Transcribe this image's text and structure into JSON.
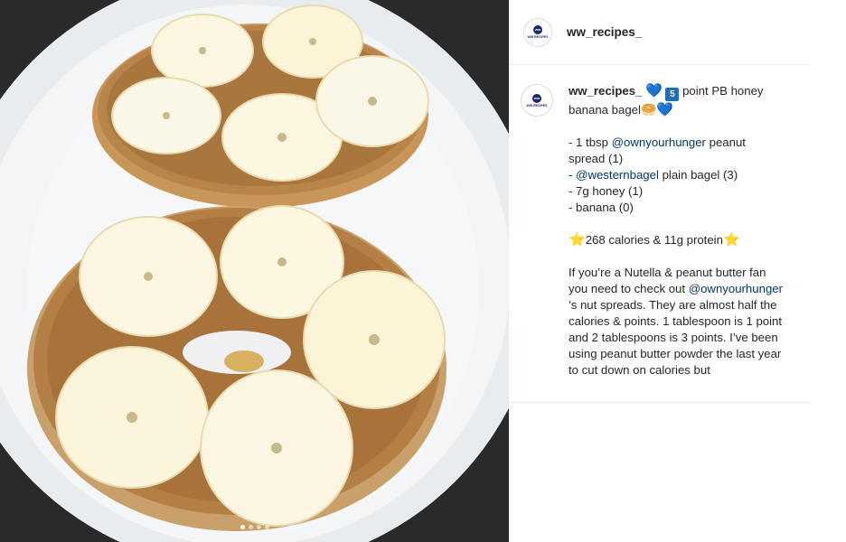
{
  "post": {
    "username": "ww_recipes_",
    "avatar_label": "WW RECIPES",
    "avatar_mark": "ww",
    "caption": {
      "username": "ww_recipes_",
      "title_part1": "point PB honey",
      "title_part2": "banana bagel",
      "emoji_heart": "💙",
      "emoji_number": "5",
      "emoji_bagel": "🥯",
      "ingredients": [
        {
          "prefix": "- 1 tbsp ",
          "mention": "@ownyourhunger",
          "suffix": " peanut spread (1)"
        },
        {
          "prefix": "- ",
          "mention": "@westernbagel",
          "suffix": " plain bagel (3)"
        },
        {
          "prefix": "- 7g honey (1)",
          "mention": "",
          "suffix": ""
        },
        {
          "prefix": "- banana (0)",
          "mention": "",
          "suffix": ""
        }
      ],
      "emoji_star": "⭐",
      "nutrition": "268 calories & 11g protein",
      "body_intro": "If you’re a Nutella & peanut butter fan you need to check out ",
      "body_mention": "@ownyourhunger",
      "body_rest": " ’s nut spreads. They are almost half the calories & points. 1 tablespoon is 1 point and 2 tablespoons is 3 points. I’ve been using peanut butter powder the last year to cut down on calories but"
    }
  },
  "carousel": {
    "dots": 4,
    "active_index": 0
  },
  "photo": {
    "description_icon": "photo-image"
  }
}
